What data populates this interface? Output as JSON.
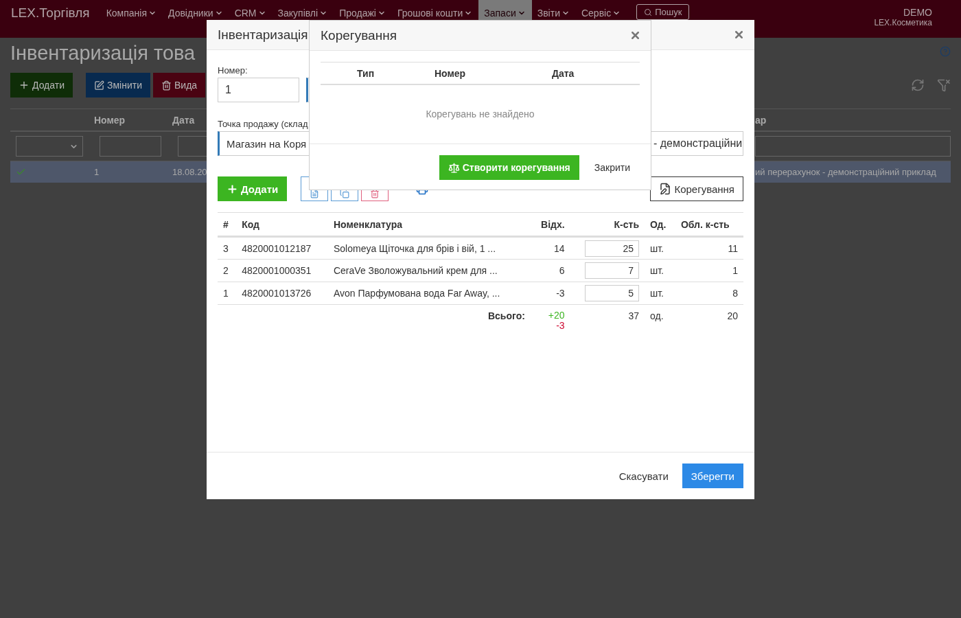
{
  "navbar": {
    "brand": "LEX.Торгівля",
    "items": [
      {
        "label": "Компанія",
        "selected": false
      },
      {
        "label": "Довідники",
        "selected": false
      },
      {
        "label": "CRM",
        "selected": false
      },
      {
        "label": "Закупівлі",
        "selected": false
      },
      {
        "label": "Продажі",
        "selected": false
      },
      {
        "label": "Грошові кошти",
        "selected": false
      },
      {
        "label": "Запаси",
        "selected": true
      },
      {
        "label": "Звіти",
        "selected": false
      },
      {
        "label": "Сервіс",
        "selected": false
      }
    ],
    "search": "Пошук",
    "user": "DEMO",
    "company": "LEX.Косметика"
  },
  "page": {
    "title": "Інвентаризація това",
    "buttons": [
      {
        "kind": "add",
        "label": "Додати"
      },
      {
        "kind": "edit",
        "label": "Змінити"
      },
      {
        "kind": "delete",
        "label": "Вида"
      }
    ],
    "columns": [
      "Номер",
      "Дата"
    ],
    "column_right": "ар",
    "row": {
      "selected": true,
      "posted": true,
      "cells": [
        "1",
        "18.08.20"
      ],
      "description": "ий перерахунок - демонстраційний приклад"
    }
  },
  "document_dialog": {
    "title": "Інвентаризація",
    "number_label": "Номер:",
    "number": "1",
    "store_label": "Точка продажу (склад",
    "store": "Магазин на Коря",
    "comment": "- демонстраційни",
    "add_button": "Додати",
    "corrections_button": "Корегування",
    "columns": [
      "#",
      "Код",
      "Номенклатура",
      "Відх.",
      "К-сть",
      "Од.",
      "Обл. к-сть"
    ],
    "rows": [
      {
        "index": "3",
        "code": "4820001012187",
        "name": "Solomeya Щіточка для брів і вій, 1 ...",
        "deviation": "14",
        "quantity": "25",
        "unit": "шт.",
        "book_quantity": "11"
      },
      {
        "index": "2",
        "code": "4820001000351",
        "name": "CeraVe Зволожувальний крем для ...",
        "deviation": "6",
        "quantity": "7",
        "unit": "шт.",
        "book_quantity": "1"
      },
      {
        "index": "1",
        "code": "4820001013726",
        "name": "Avon Парфумована вода Far Away, ...",
        "deviation": "-3",
        "quantity": "5",
        "unit": "шт.",
        "book_quantity": "8"
      }
    ],
    "total": {
      "label": "Всього:",
      "surplus": "+20",
      "shortage": "-3",
      "quantity": "37",
      "unit": "од.",
      "book_quantity": "20"
    },
    "cancel": "Скасувати",
    "save": "Зберегти"
  },
  "corrections_dialog": {
    "title": "Корегування",
    "columns": [
      "Тип",
      "Номер",
      "Дата"
    ],
    "empty": "Корегувань не знайдено",
    "create": "Створити корегування",
    "close": "Закрити"
  }
}
